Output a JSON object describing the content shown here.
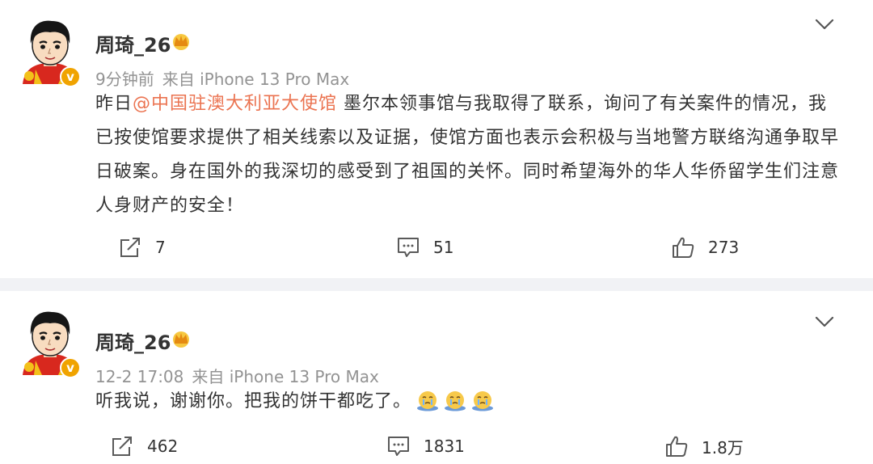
{
  "colors": {
    "mention": "#eb7350",
    "meta": "#939393",
    "badge": "#f0a300",
    "divider": "#f1f2f5"
  },
  "posts": [
    {
      "user": {
        "name": "周琦_26",
        "avatar_icon": "cartoon-avatar-icon",
        "verified_icon": "verified-badge-icon",
        "vip_icon": "crown-icon"
      },
      "meta": {
        "time": "9分钟前",
        "source": "来自 iPhone 13 Pro Max"
      },
      "text": {
        "prefix": "昨日",
        "mention": "@中国驻澳大利亚大使馆",
        "body": " 墨尔本领事馆与我取得了联系，询问了有关案件的情况，我已按使馆要求提供了相关线索以及证据，使馆方面也表示会积极与当地警方联络沟通争取早日破案。身在国外的我深切的感受到了祖国的关怀。同时希望海外的华人华侨留学生们注意人身财产的安全！"
      },
      "actions": {
        "repost": "7",
        "comment": "51",
        "like": "273"
      }
    },
    {
      "user": {
        "name": "周琦_26",
        "avatar_icon": "cartoon-avatar-icon",
        "verified_icon": "verified-badge-icon",
        "vip_icon": "crown-icon"
      },
      "meta": {
        "time": "12-2 17:08",
        "source": "来自 iPhone 13 Pro Max"
      },
      "text": {
        "body": "听我说，谢谢你。把我的饼干都吃了。",
        "emojis": [
          "crying-face-emoji",
          "crying-face-emoji",
          "crying-face-emoji"
        ]
      },
      "actions": {
        "repost": "462",
        "comment": "1831",
        "like": "1.8万"
      }
    }
  ]
}
